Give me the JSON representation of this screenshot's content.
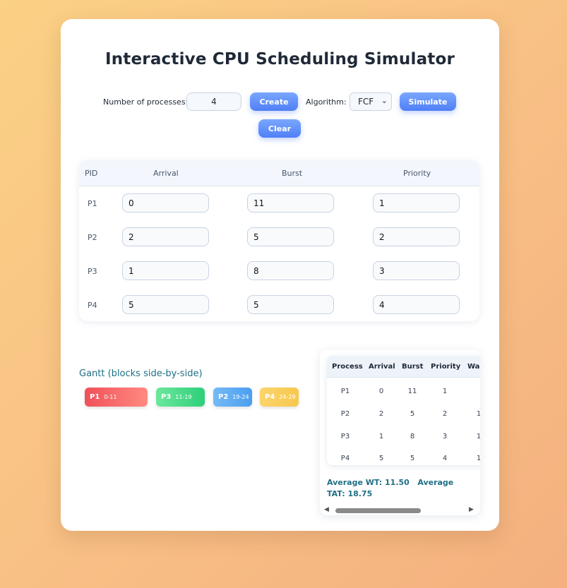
{
  "title": "Interactive CPU Scheduling Simulator",
  "controls": {
    "num_processes_label": "Number of processes:",
    "num_processes_value": "4",
    "create_label": "Create",
    "algorithm_label": "Algorithm:",
    "algorithm_value": "FCF",
    "simulate_label": "Simulate",
    "clear_label": "Clear"
  },
  "process_table": {
    "headers": [
      "PID",
      "Arrival",
      "Burst",
      "Priority"
    ],
    "rows": [
      {
        "pid": "P1",
        "arrival": "0",
        "burst": "11",
        "priority": "1"
      },
      {
        "pid": "P2",
        "arrival": "2",
        "burst": "5",
        "priority": "2"
      },
      {
        "pid": "P3",
        "arrival": "1",
        "burst": "8",
        "priority": "3"
      },
      {
        "pid": "P4",
        "arrival": "5",
        "burst": "5",
        "priority": "4"
      }
    ]
  },
  "gantt": {
    "title": "Gantt (blocks side-by-side)",
    "blocks": [
      {
        "label": "P1",
        "range": "0-11",
        "color_from": "#f0505a",
        "color_to": "#ff8a80"
      },
      {
        "label": "P3",
        "range": "11-19",
        "color_from": "#52e08e",
        "color_to": "#2ecf7a"
      },
      {
        "label": "P2",
        "range": "19-24",
        "color_from": "#6bb4f5",
        "color_to": "#4a9eef"
      },
      {
        "label": "P4",
        "range": "24-29",
        "color_from": "#fbd46a",
        "color_to": "#f8c850"
      }
    ]
  },
  "results": {
    "headers": [
      "Process",
      "Arrival",
      "Burst",
      "Priority",
      "Wa"
    ],
    "rows": [
      {
        "process": "P1",
        "arrival": "0",
        "burst": "11",
        "priority": "1",
        "wait": ""
      },
      {
        "process": "P2",
        "arrival": "2",
        "burst": "5",
        "priority": "2",
        "wait": "1"
      },
      {
        "process": "P3",
        "arrival": "1",
        "burst": "8",
        "priority": "3",
        "wait": "1"
      },
      {
        "process": "P4",
        "arrival": "5",
        "burst": "5",
        "priority": "4",
        "wait": "1"
      }
    ],
    "avg_wt_text": "Average WT: 11.50",
    "avg_tat_prefix": "Average",
    "avg_tat_text": "TAT: 18.75"
  },
  "colors": {
    "accent": "#4f7ff5",
    "teal_text": "#1e6f86"
  }
}
